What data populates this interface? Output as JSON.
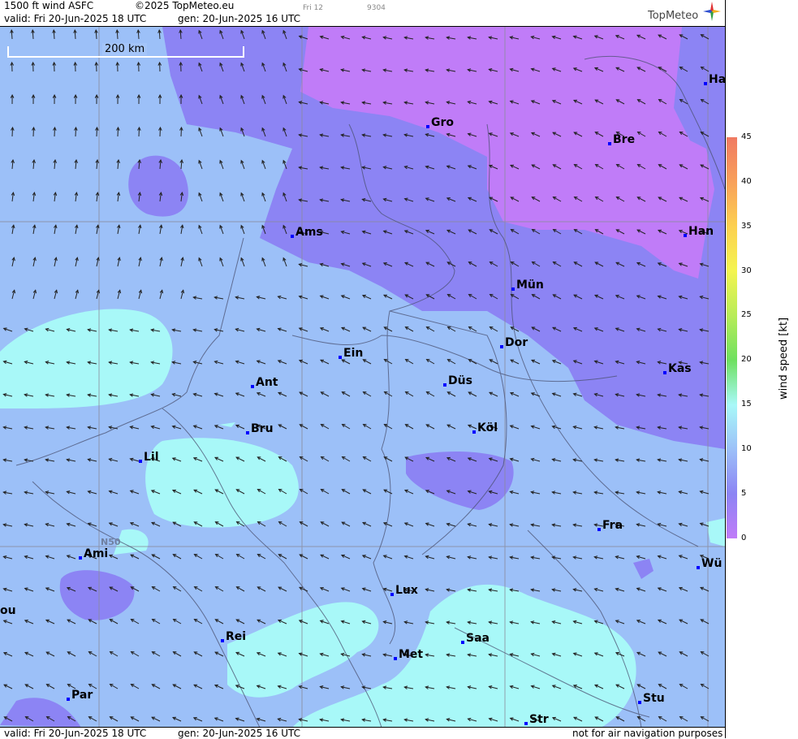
{
  "header": {
    "product": "1500 ft wind ASFC",
    "copyright": "©2025 TopMeteo.eu",
    "slot": "Fri 12",
    "code": "9304",
    "valid": "valid:  Fri   20-Jun-2025  18 UTC",
    "gen": "gen: 20-Jun-2025 16 UTC",
    "logo": "TopMeteo"
  },
  "footer": {
    "valid": "valid:  Fri   20-Jun-2025  18 UTC",
    "gen": "gen: 20-Jun-2025 16 UTC",
    "note": "not for air navigation purposes"
  },
  "map": {
    "scale_label": "200 km",
    "grid_label": "N50",
    "cities": [
      {
        "name": "Ha"
      },
      {
        "name": "Gro"
      },
      {
        "name": "Bre"
      },
      {
        "name": "Ams"
      },
      {
        "name": "Han"
      },
      {
        "name": "Mün"
      },
      {
        "name": "Dor"
      },
      {
        "name": "Ein"
      },
      {
        "name": "Kas"
      },
      {
        "name": "Ant"
      },
      {
        "name": "Düs"
      },
      {
        "name": "Köl"
      },
      {
        "name": "Bru"
      },
      {
        "name": "Lil"
      },
      {
        "name": "Fra"
      },
      {
        "name": "Ami"
      },
      {
        "name": "Wü"
      },
      {
        "name": "Lux"
      },
      {
        "name": "ou"
      },
      {
        "name": "Rei"
      },
      {
        "name": "Saa"
      },
      {
        "name": "Met"
      },
      {
        "name": "Par"
      },
      {
        "name": "Stu"
      },
      {
        "name": "Str"
      }
    ]
  },
  "legend": {
    "title": "wind  speed  [kt]",
    "ticks": [
      "45",
      "40",
      "35",
      "30",
      "25",
      "20",
      "15",
      "10",
      "5",
      "0"
    ],
    "colors": [
      "#f07a62",
      "#f8a05a",
      "#fcd050",
      "#f4f450",
      "#b8ec58",
      "#6ee060",
      "#a8f8f8",
      "#9cc0f8",
      "#8c84f4",
      "#c07cf8"
    ]
  }
}
